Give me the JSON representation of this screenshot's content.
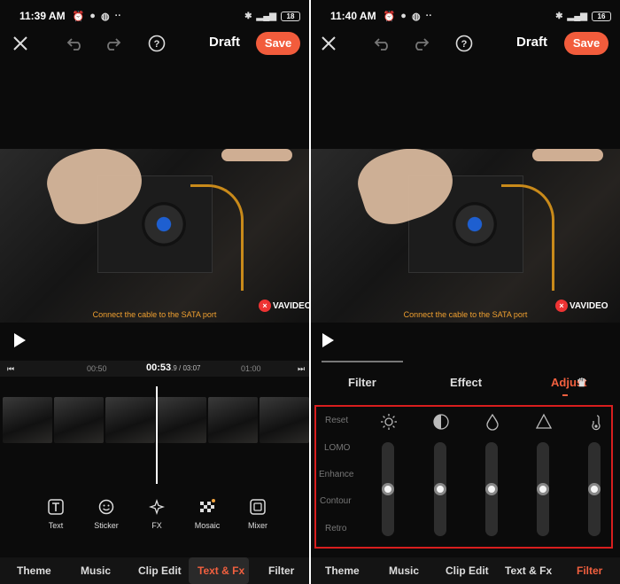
{
  "left": {
    "status": {
      "time": "11:39 AM",
      "battery": "18"
    },
    "toolbar": {
      "title": "Draft",
      "save_label": "Save"
    },
    "video": {
      "caption": "Connect the cable to the SATA port",
      "watermark": "VAVIDEO"
    },
    "timeline": {
      "start_label": "00:50",
      "current": "00:53",
      "current_fraction": ".9",
      "total": "03:07",
      "end_label": "01:00"
    },
    "tools": [
      {
        "label": "Text",
        "icon": "text-icon"
      },
      {
        "label": "Sticker",
        "icon": "sticker-icon"
      },
      {
        "label": "FX",
        "icon": "fx-icon"
      },
      {
        "label": "Mosaic",
        "icon": "mosaic-icon"
      },
      {
        "label": "Mixer",
        "icon": "mixer-icon"
      }
    ],
    "nav": [
      "Theme",
      "Music",
      "Clip Edit",
      "Text & Fx",
      "Filter"
    ],
    "nav_active": "Text & Fx"
  },
  "right": {
    "status": {
      "time": "11:40 AM",
      "battery": "16"
    },
    "toolbar": {
      "title": "Draft",
      "save_label": "Save"
    },
    "video": {
      "caption": "Connect the cable to the SATA port",
      "watermark": "VAVIDEO"
    },
    "tabs": [
      "Filter",
      "Effect",
      "Adjust"
    ],
    "tab_active": "Adjust",
    "filters": [
      "Reset",
      "LOMO",
      "Enhance",
      "Contour",
      "Retro"
    ],
    "adjust_controls": [
      {
        "icon": "brightness-icon",
        "level": 0.5
      },
      {
        "icon": "contrast-icon",
        "level": 0.5
      },
      {
        "icon": "saturation-icon",
        "level": 0.5
      },
      {
        "icon": "sharpen-icon",
        "level": 0.5
      },
      {
        "icon": "temperature-icon",
        "level": 0.5
      }
    ],
    "nav": [
      "Theme",
      "Music",
      "Clip Edit",
      "Text & Fx",
      "Filter"
    ],
    "nav_active": "Filter"
  },
  "colors": {
    "accent": "#f2603f",
    "highlight_box": "#d81e1e"
  }
}
